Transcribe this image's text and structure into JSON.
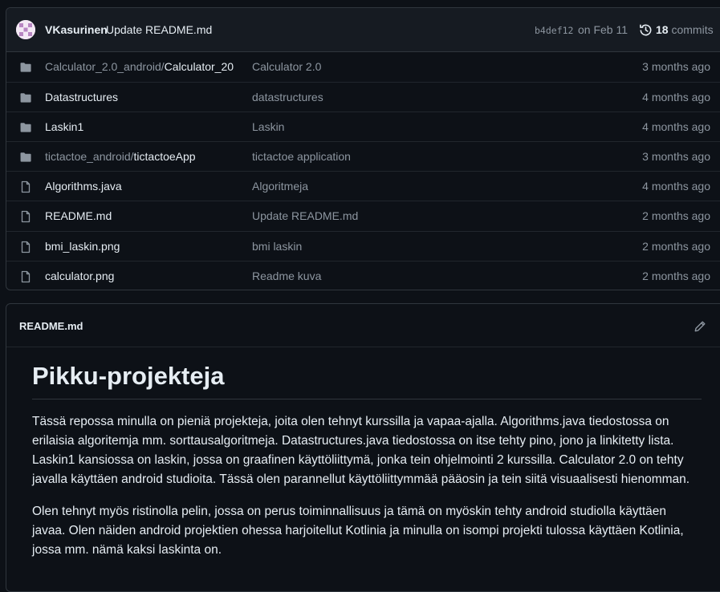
{
  "commit": {
    "author": "VKasurinen",
    "message": "Update README.md",
    "hash": "b4def12",
    "date": "on Feb 11",
    "count": "18",
    "count_label": "commits"
  },
  "files": [
    {
      "type": "folder",
      "prefix": "Calculator_2.0_android/",
      "name": "Calculator_20",
      "commit": "Calculator 2.0",
      "age": "3 months ago"
    },
    {
      "type": "folder",
      "prefix": "",
      "name": "Datastructures",
      "commit": "datastructures",
      "age": "4 months ago"
    },
    {
      "type": "folder",
      "prefix": "",
      "name": "Laskin1",
      "commit": "Laskin",
      "age": "4 months ago"
    },
    {
      "type": "folder",
      "prefix": "tictactoe_android/",
      "name": "tictactoeApp",
      "commit": "tictactoe application",
      "age": "3 months ago"
    },
    {
      "type": "file",
      "prefix": "",
      "name": "Algorithms.java",
      "commit": "Algoritmeja",
      "age": "4 months ago"
    },
    {
      "type": "file",
      "prefix": "",
      "name": "README.md",
      "commit": "Update README.md",
      "age": "2 months ago"
    },
    {
      "type": "file",
      "prefix": "",
      "name": "bmi_laskin.png",
      "commit": "bmi laskin",
      "age": "2 months ago"
    },
    {
      "type": "file",
      "prefix": "",
      "name": "calculator.png",
      "commit": "Readme kuva",
      "age": "2 months ago"
    }
  ],
  "readme": {
    "filename": "README.md",
    "heading": "Pikku-projekteja",
    "paragraphs": [
      "Tässä repossa minulla on pieniä projekteja, joita olen tehnyt kurssilla ja vapaa-ajalla. Algorithms.java tiedostossa on erilaisia algoritemja mm. sorttausalgoritmeja. Datastructures.java tiedostossa on itse tehty pino, jono ja linkitetty lista. Laskin1 kansiossa on laskin, jossa on graafinen käyttöliittymä, jonka tein ohjelmointi 2 kurssilla. Calculator 2.0 on tehty javalla käyttäen android studioita. Tässä olen parannellut käyttöliittymmää pääosin ja tein siitä visuaalisesti hienomman.",
      "Olen tehnyt myös ristinolla pelin, jossa on perus toiminnallisuus ja tämä on myöskin tehty android studiolla käyttäen javaa. Olen näiden android projektien ohessa harjoitellut Kotlinia ja minulla on isompi projekti tulossa käyttäen Kotlinia, jossa mm. nämä kaksi laskinta on."
    ]
  },
  "icons": {
    "folder": "folder-icon",
    "file": "file-icon",
    "history": "history-icon",
    "edit": "pencil-icon"
  },
  "colors": {
    "background": "#0d1117",
    "header": "#161b22",
    "border": "#30363d",
    "text": "#e6edf3",
    "muted": "#8d96a0"
  }
}
